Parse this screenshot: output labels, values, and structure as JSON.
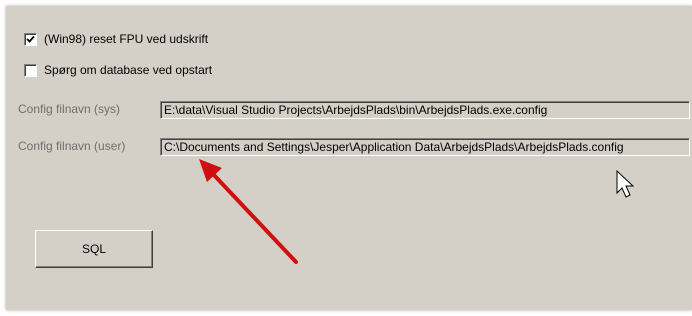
{
  "options": {
    "reset_fpu": {
      "label": "(Win98) reset FPU ved udskrift",
      "checked": true
    },
    "ask_db": {
      "label": "Spørg om database ved opstart",
      "checked": false
    }
  },
  "config": {
    "sys_label": "Config filnavn (sys)",
    "sys_value": "E:\\data\\Visual Studio Projects\\ArbejdsPlads\\bin\\ArbejdsPlads.exe.config",
    "user_label": "Config filnavn (user)",
    "user_value": "C:\\Documents and Settings\\Jesper\\Application Data\\ArbejdsPlads\\ArbejdsPlads.config"
  },
  "buttons": {
    "sql_label": "SQL"
  },
  "annotation": {
    "arrow_color": "#d01010"
  },
  "cursor": {
    "icon": "arrow-cursor-icon"
  }
}
